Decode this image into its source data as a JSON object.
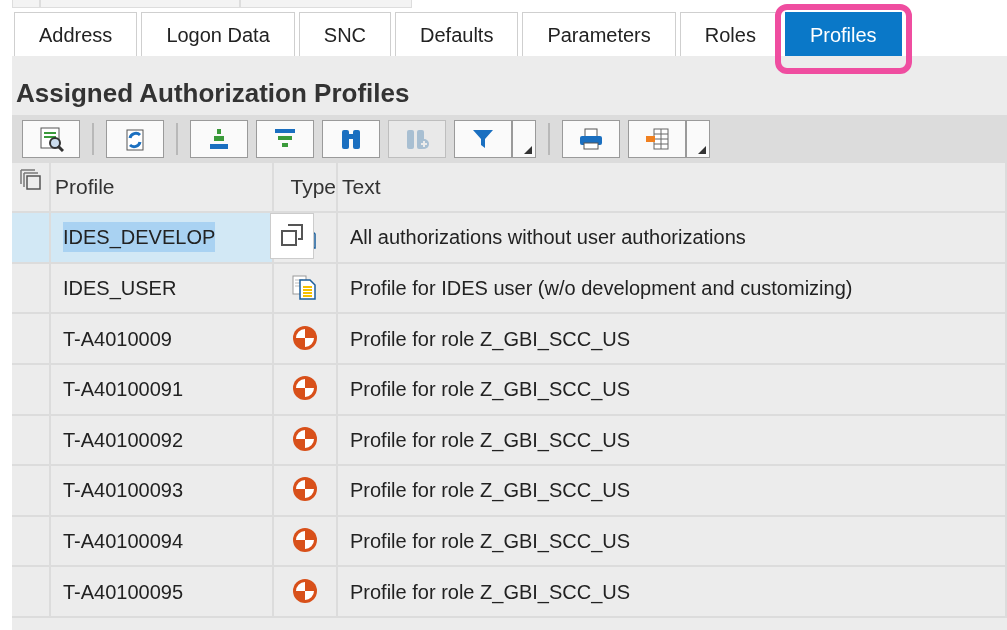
{
  "tabs": [
    {
      "label": "Address",
      "selected": false
    },
    {
      "label": "Logon Data",
      "selected": false
    },
    {
      "label": "SNC",
      "selected": false
    },
    {
      "label": "Defaults",
      "selected": false
    },
    {
      "label": "Parameters",
      "selected": false
    },
    {
      "label": "Roles",
      "selected": false
    },
    {
      "label": "Profiles",
      "selected": true,
      "highlighted": true
    }
  ],
  "section_title": "Assigned Authorization Profiles",
  "toolbar_groups": [
    [
      {
        "kind": "details",
        "disabled": false,
        "dropdown": false
      }
    ],
    [
      {
        "kind": "refresh",
        "disabled": false,
        "dropdown": false
      }
    ],
    [
      {
        "kind": "sort-ascending",
        "disabled": false,
        "dropdown": false
      },
      {
        "kind": "sort-descending",
        "disabled": false,
        "dropdown": false
      },
      {
        "kind": "find",
        "disabled": false,
        "dropdown": false
      },
      {
        "kind": "find-next",
        "disabled": true,
        "dropdown": false
      },
      {
        "kind": "filter",
        "disabled": false,
        "dropdown": true
      }
    ],
    [
      {
        "kind": "print",
        "disabled": false,
        "dropdown": false
      },
      {
        "kind": "layout",
        "disabled": false,
        "dropdown": true
      }
    ]
  ],
  "table": {
    "columns": [
      "Profile",
      "Type",
      "Text"
    ],
    "rows": [
      {
        "profile": "IDES_DEVELOP",
        "kind": "composite",
        "text": "All authorizations without user authorizations",
        "selected": true
      },
      {
        "profile": "IDES_USER",
        "kind": "composite",
        "text": "Profile for IDES user (w/o development and customizing)",
        "selected": false
      },
      {
        "profile": "T-A4010009",
        "kind": "single",
        "text": "Profile for role Z_GBI_SCC_US",
        "selected": false
      },
      {
        "profile": "T-A40100091",
        "kind": "single",
        "text": "Profile for role Z_GBI_SCC_US",
        "selected": false
      },
      {
        "profile": "T-A40100092",
        "kind": "single",
        "text": "Profile for role Z_GBI_SCC_US",
        "selected": false
      },
      {
        "profile": "T-A40100093",
        "kind": "single",
        "text": "Profile for role Z_GBI_SCC_US",
        "selected": false
      },
      {
        "profile": "T-A40100094",
        "kind": "single",
        "text": "Profile for role Z_GBI_SCC_US",
        "selected": false
      },
      {
        "profile": "T-A40100095",
        "kind": "single",
        "text": "Profile for role Z_GBI_SCC_US",
        "selected": false
      }
    ]
  }
}
